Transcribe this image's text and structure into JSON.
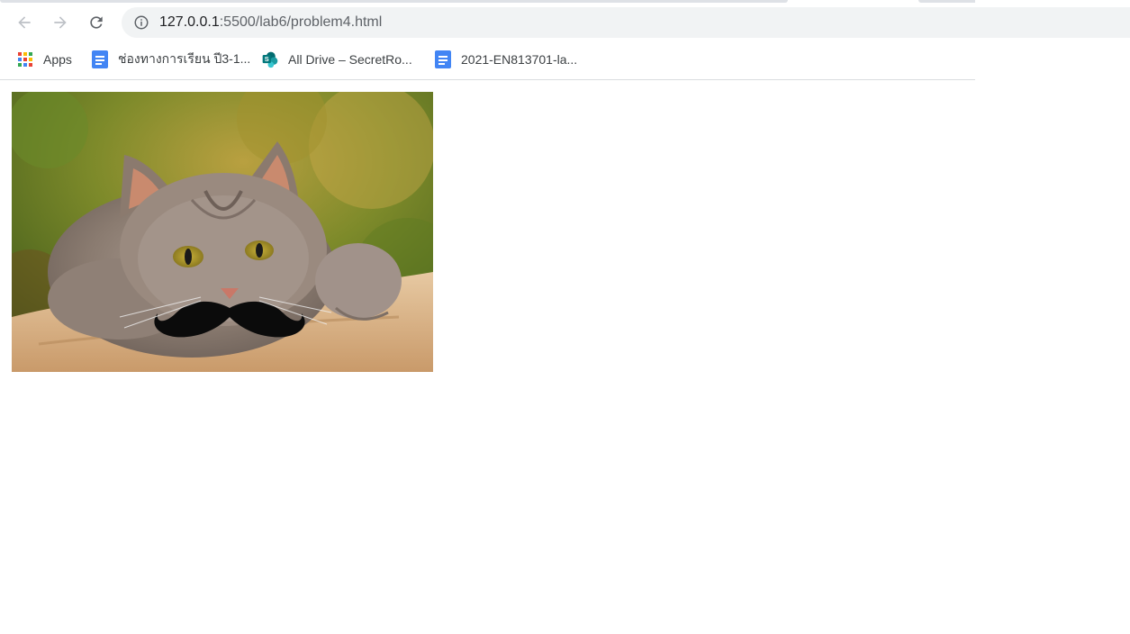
{
  "browser": {
    "url_host": "127.0.0.1",
    "url_rest": ":5500/lab6/problem4.html",
    "icons": {
      "back": "back-arrow-icon",
      "forward": "forward-arrow-icon",
      "reload": "reload-icon",
      "info": "info-icon"
    }
  },
  "bookmarks": [
    {
      "label": "Apps",
      "icon": "apps-grid-icon"
    },
    {
      "label": "ช่องทางการเรียน ปี3-1...",
      "icon": "google-docs-icon"
    },
    {
      "label": "All Drive – SecretRo...",
      "icon": "sharepoint-icon"
    },
    {
      "label": "2021-EN813701-la...",
      "icon": "google-docs-icon"
    }
  ],
  "content": {
    "image_icon": "cat-with-mustache-image"
  },
  "colors": {
    "toolbar_bg": "#ffffff",
    "omnibox_bg": "#f1f3f4",
    "docs_blue": "#4285f4",
    "sharepoint_teal": "#038387"
  }
}
